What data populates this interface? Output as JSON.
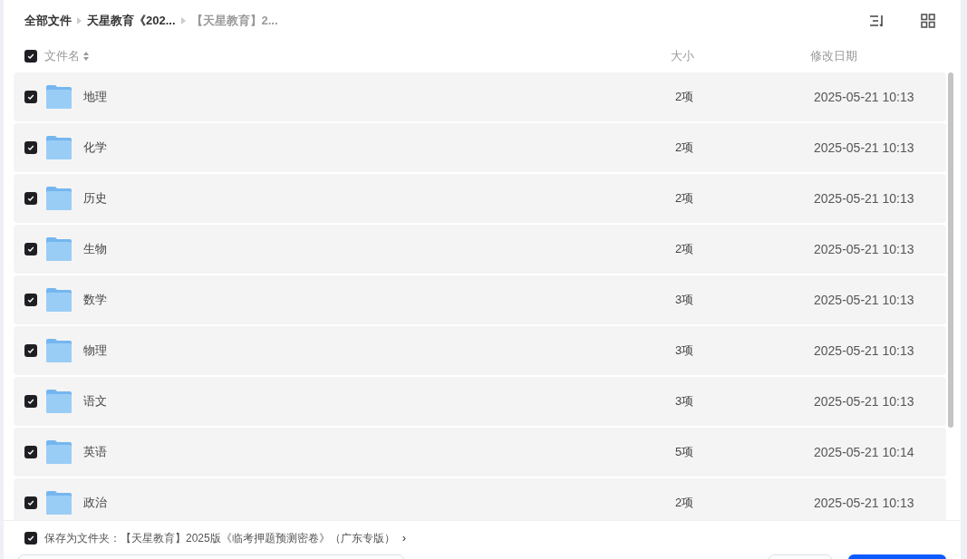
{
  "breadcrumb": [
    {
      "label": "全部文件",
      "current": false
    },
    {
      "label": "天星教育《202...",
      "current": false
    },
    {
      "label": "【天星教育】2...",
      "current": true
    }
  ],
  "table": {
    "select_all": {
      "checked": true
    },
    "columns": [
      "文件名",
      "大小",
      "修改日期"
    ],
    "rows": [
      {
        "name": "地理",
        "size": "2项",
        "modified": "2025-05-21 10:13",
        "selected": true
      },
      {
        "name": "化学",
        "size": "2项",
        "modified": "2025-05-21 10:13",
        "selected": true
      },
      {
        "name": "历史",
        "size": "2项",
        "modified": "2025-05-21 10:13",
        "selected": true
      },
      {
        "name": "生物",
        "size": "2项",
        "modified": "2025-05-21 10:13",
        "selected": true
      },
      {
        "name": "数学",
        "size": "3项",
        "modified": "2025-05-21 10:13",
        "selected": true
      },
      {
        "name": "物理",
        "size": "3项",
        "modified": "2025-05-21 10:13",
        "selected": true
      },
      {
        "name": "语文",
        "size": "3项",
        "modified": "2025-05-21 10:13",
        "selected": true
      },
      {
        "name": "英语",
        "size": "5项",
        "modified": "2025-05-21 10:14",
        "selected": true
      },
      {
        "name": "政治",
        "size": "2项",
        "modified": "2025-05-21 10:13",
        "selected": true
      }
    ]
  },
  "save_as_folder": {
    "checked": true,
    "label": "保存为文件夹：【天星教育】2025版《临考押题预测密卷》（广东专版）",
    "arrow": "›"
  }
}
